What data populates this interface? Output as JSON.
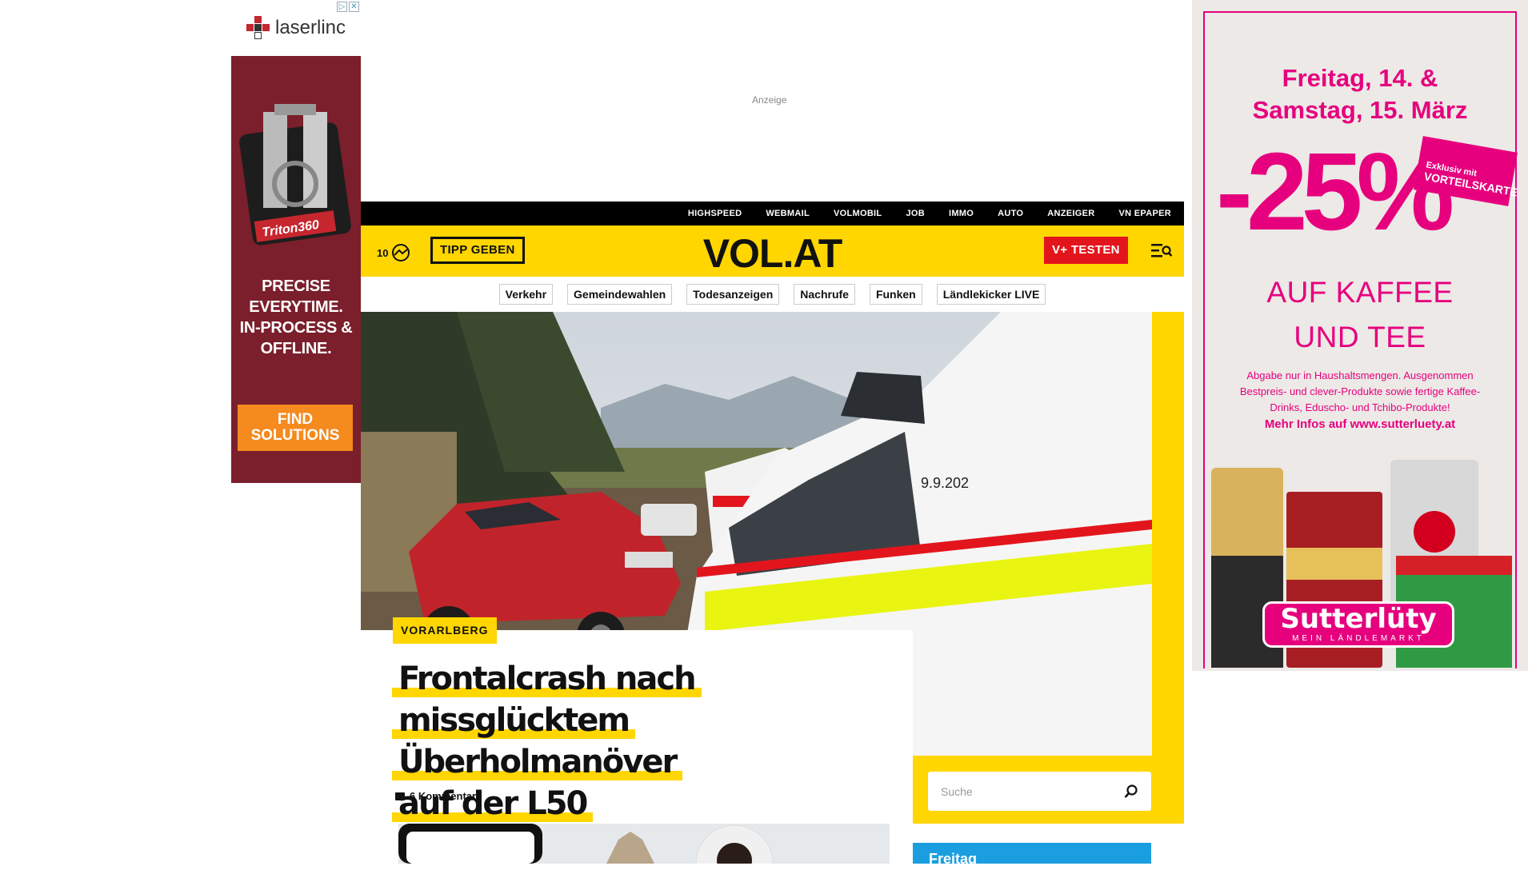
{
  "ad_left": {
    "logo": "laserlinc",
    "product": "Triton360",
    "headline": [
      "PRECISE",
      "EVERYTIME.",
      "IN-PROCESS &",
      "OFFLINE."
    ],
    "cta": [
      "FIND",
      "SOLUTIONS"
    ],
    "brand_color": "#7a1f2b",
    "cta_color": "#f58a1f"
  },
  "top_ad": {
    "label": "Anzeige"
  },
  "topbar": {
    "links": [
      "HIGHSPEED",
      "WEBMAIL",
      "VOLMOBIL",
      "JOB",
      "IMMO",
      "AUTO",
      "ANZEIGER",
      "VN EPAPER"
    ]
  },
  "header": {
    "temperature": "10",
    "weather_icon": "weather-icon",
    "tipp_label": "TIPP GEBEN",
    "logo": "VOL.AT",
    "vplus_label": "V+ TESTEN",
    "menu_icon": "menu-search-icon",
    "accent": "#ffd600",
    "red": "#e3151c"
  },
  "topics": [
    "Verkehr",
    "Gemeindewahlen",
    "Todesanzeigen",
    "Nachrufe",
    "Funken",
    "Ländlekicker LIVE"
  ],
  "hero": {
    "kicker": "VORARLBERG",
    "headline_lines": [
      "Frontalcrash nach",
      "missglücktem Überholmanöver",
      "auf der L50"
    ],
    "comments": "6 Kommentare",
    "vehicle_number": "9.9.202"
  },
  "search": {
    "placeholder": "Suche"
  },
  "sidebar_teaser": {
    "label": "Freitag"
  },
  "ad_right": {
    "date_lines": [
      "Freitag, 14. &",
      "Samstag, 15. März"
    ],
    "discount": "-25%",
    "stamp": [
      "Exklusiv mit",
      "VORTEILSKARTE"
    ],
    "sub_lines": [
      "AUF KAFFEE",
      "UND TEE"
    ],
    "fine_print": "Abgabe nur in Haushaltsmengen. Ausgenommen Bestpreis- und clever-Produkte sowie fertige Kaffee-Drinks, Eduscho- und Tchibo-Produkte!",
    "more": "Mehr Infos auf www.sutterluety.at",
    "brand": "Sutterlüty",
    "brand_tag": "MEIN LÄNDLEMARKT",
    "color": "#e6007e"
  }
}
